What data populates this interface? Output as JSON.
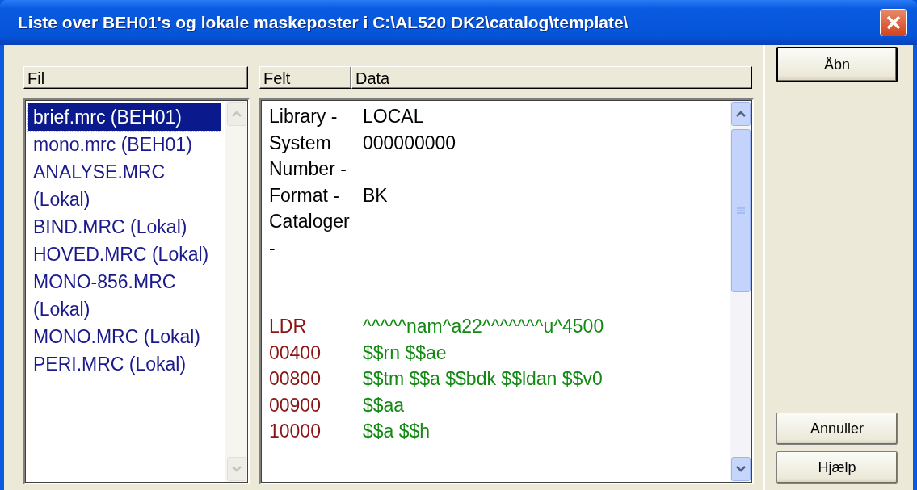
{
  "window": {
    "title": "Liste over BEH01's og lokale maskeposter i C:\\AL520 DK2\\catalog\\template\\"
  },
  "file_list": {
    "header": "Fil",
    "items": [
      {
        "label": "brief.mrc (BEH01)",
        "selected": true
      },
      {
        "label": "mono.mrc (BEH01)",
        "selected": false
      },
      {
        "label": "ANALYSE.MRC (Lokal)",
        "selected": false
      },
      {
        "label": "BIND.MRC (Lokal)",
        "selected": false
      },
      {
        "label": "HOVED.MRC (Lokal)",
        "selected": false
      },
      {
        "label": "MONO-856.MRC (Lokal)",
        "selected": false
      },
      {
        "label": "MONO.MRC (Lokal)",
        "selected": false
      },
      {
        "label": "PERI.MRC (Lokal)",
        "selected": false
      }
    ]
  },
  "record": {
    "columns": [
      "Felt",
      "Data"
    ],
    "rows": [
      {
        "kind": "info",
        "field": "Library -",
        "data": "LOCAL"
      },
      {
        "kind": "info",
        "field": "System Number -",
        "data": "000000000"
      },
      {
        "kind": "info",
        "field": "Format -",
        "data": "BK"
      },
      {
        "kind": "info",
        "field": "Cataloger -"
      },
      {
        "kind": "marc",
        "field": "LDR",
        "data": "^^^^^nam^a22^^^^^^^u^4500"
      },
      {
        "kind": "marc",
        "field": "00400",
        "data": "$$rn $$ae"
      },
      {
        "kind": "marc",
        "field": "00800",
        "data": "$$tm $$a $$bdk $$ldan $$v0"
      },
      {
        "kind": "marc",
        "field": "00900",
        "data": "$$aa"
      },
      {
        "kind": "marc",
        "field": "10000",
        "data": "$$a $$h"
      }
    ]
  },
  "buttons": [
    {
      "label": "Åbn",
      "default": true
    },
    {
      "label": "Annuller",
      "default": false
    },
    {
      "label": "Hjælp",
      "default": false
    }
  ]
}
